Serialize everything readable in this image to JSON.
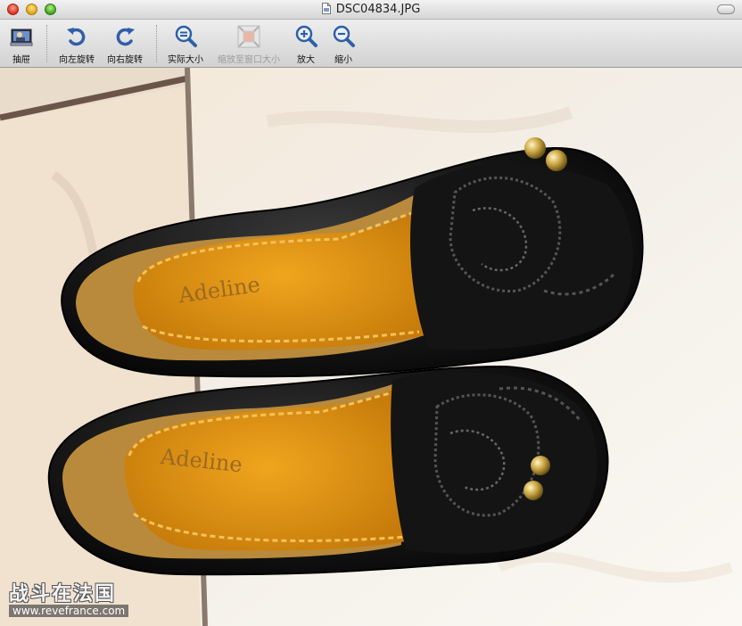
{
  "window": {
    "title": "DSC04834.JPG"
  },
  "toolbar": {
    "items": [
      {
        "label": "抽屉",
        "icon": "drawer-icon"
      },
      {
        "label": "向左旋转",
        "icon": "rotate-left-icon"
      },
      {
        "label": "向右旋转",
        "icon": "rotate-right-icon"
      },
      {
        "label": "实际大小",
        "icon": "actual-size-icon"
      },
      {
        "label": "缩放至窗口大小",
        "icon": "zoom-to-fit-icon",
        "disabled": true
      },
      {
        "label": "放大",
        "icon": "zoom-in-icon"
      },
      {
        "label": "缩小",
        "icon": "zoom-out-icon"
      }
    ]
  },
  "photo": {
    "insole_text_top": "Adeline",
    "insole_text_bottom": "Adeline"
  },
  "watermark": {
    "chinese": "战斗在法国",
    "url": "www.revefrance.com"
  }
}
